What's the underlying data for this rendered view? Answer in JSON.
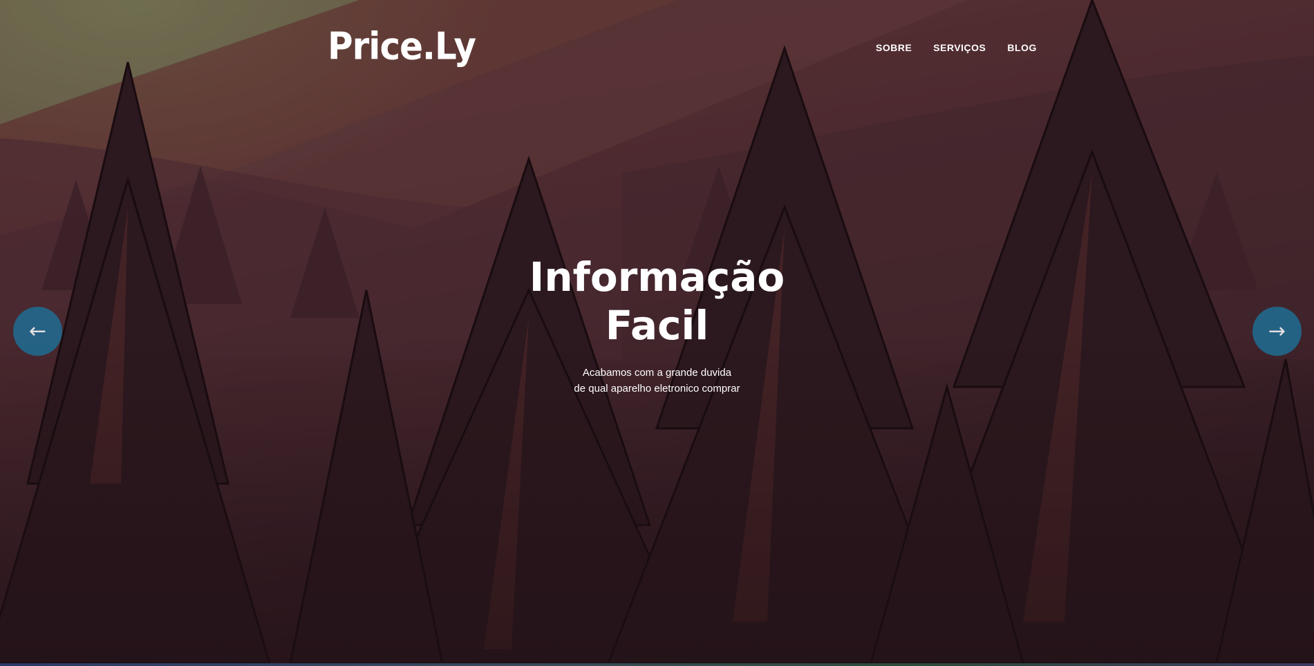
{
  "brand": {
    "logo_text": "Price.Ly"
  },
  "nav": {
    "items": [
      {
        "label": "SOBRE"
      },
      {
        "label": "SERVIÇOS"
      },
      {
        "label": "BLOG"
      }
    ]
  },
  "hero": {
    "headline_line1": "Informação",
    "headline_line2": "Facil",
    "subtitle_line1": "Acabamos com a grande duvida",
    "subtitle_line2": "de qual aparelho eletronico comprar",
    "background": "forest-illustration"
  },
  "carousel": {
    "prev_icon": "arrow-left-icon",
    "next_icon": "arrow-right-icon",
    "prev_glyph": "←",
    "next_glyph": "→",
    "button_color": "#1f6d93"
  }
}
